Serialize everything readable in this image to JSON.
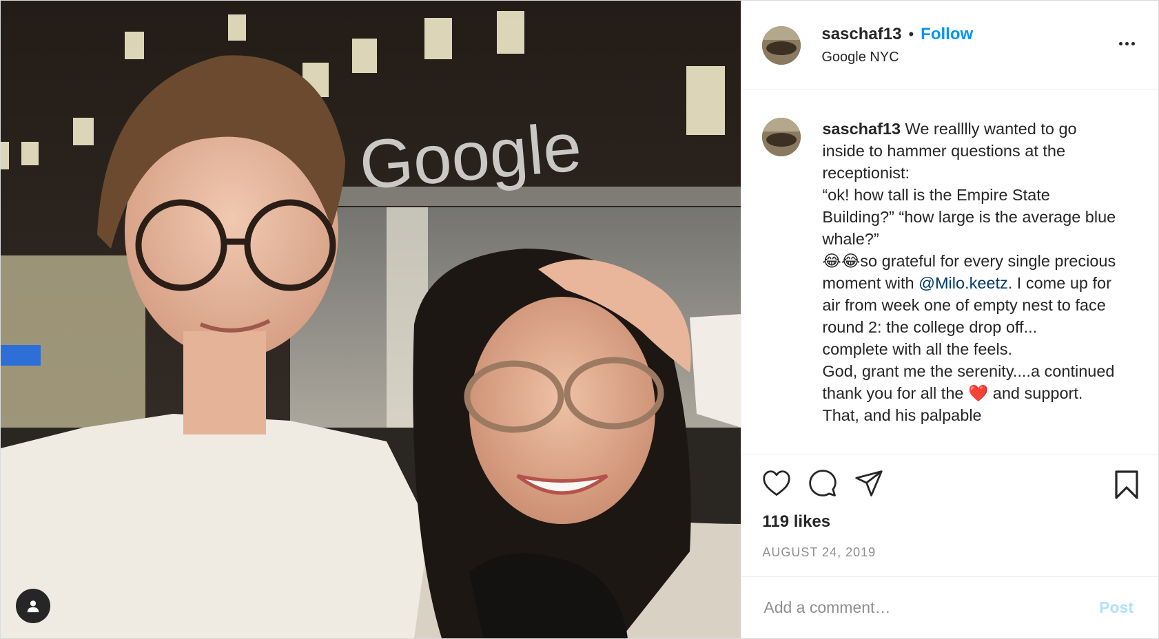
{
  "post": {
    "username": "saschaf13",
    "separator": "•",
    "follow_label": "Follow",
    "location": "Google NYC",
    "photo_sign_text": "Google",
    "caption_username": "saschaf13",
    "caption_lines": [
      " We realllly wanted to go inside to hammer questions at the receptionist:\n“ok! how tall is the Empire State Building?” “how large is the average blue whale?”\n😂😂so grateful for every single precious moment with ",
      "@Milo.keetz",
      ". I come up for air from week one of empty nest to face round 2: the college drop off...\ncomplete with all the feels.\nGod, grant me the serenity....a continued thank you for all the ❤️ and support. That, and his palpable"
    ],
    "likes": "119 likes",
    "date": "AUGUST 24, 2019",
    "comment_placeholder": "Add a comment…",
    "post_label": "Post"
  },
  "colors": {
    "accent": "#0095f6",
    "post_disabled": "#b2dffc",
    "mention": "#00376b",
    "muted": "#8e8e8e"
  },
  "icons": {
    "like": "heart-icon",
    "comment": "comment-icon",
    "share": "paper-plane-icon",
    "save": "bookmark-icon",
    "tag": "user-tag-icon",
    "more": "more-options-icon"
  }
}
